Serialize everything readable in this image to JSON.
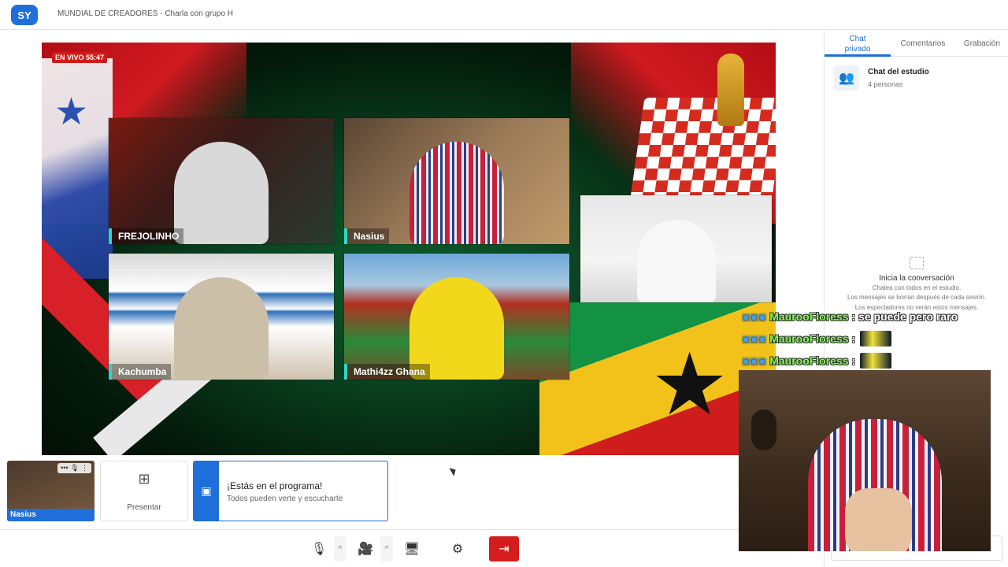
{
  "app": {
    "logo_text": "SY",
    "title": "MUNDIAL DE CREADORES - Charla con grupo H"
  },
  "stage": {
    "live_badge": "EN VIVO 55:47",
    "participants": [
      {
        "name": "FREJOLINHO"
      },
      {
        "name": "Nasius"
      },
      {
        "name": "Kachumba"
      },
      {
        "name": "Mathi4zz Ghana"
      }
    ]
  },
  "tray": {
    "self_name": "Nasius",
    "self_controls": "••• 🎙 ⋮",
    "present_label": "Presentar",
    "onair_title": "¡Estás en el programa!",
    "onair_subtitle": "Todos pueden verte y escucharte"
  },
  "controls": {
    "mic_icon": "🎙",
    "chevron": "^",
    "cam_icon": "🎥",
    "share_icon": "🖥",
    "settings_icon": "⚙",
    "leave_icon": "⇥"
  },
  "sidebar": {
    "tabs": [
      "Chat privado",
      "Comentarios",
      "Grabación"
    ],
    "studio_title": "Chat del estudio",
    "studio_subtitle": "4 personas",
    "empty_title": "Inicia la conversación",
    "empty_lines": [
      "Chatea con todos en el estudio.",
      "Los mensajes se borran después de cada sesión.",
      "Los espectadores no verán estos mensajes."
    ]
  },
  "overlay_chat": [
    {
      "user": "MaurooFloress",
      "message": ": se puede pero raro",
      "emote": false
    },
    {
      "user": "MaurooFloress",
      "message": ":",
      "emote": true
    },
    {
      "user": "MaurooFloress",
      "message": ":",
      "emote": true
    }
  ],
  "colors": {
    "accent": "#1e6fd9",
    "live": "#d21a1a",
    "leave": "#d61d1d",
    "nametag_border": "#2ed6c8",
    "chat_user": "#7cff4a"
  }
}
